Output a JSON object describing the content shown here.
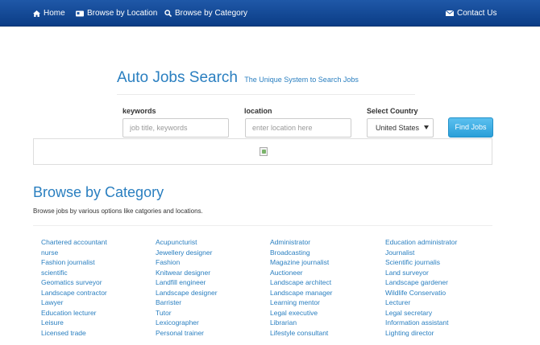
{
  "navbar": {
    "home": "Home",
    "browse_location": "Browse by Location",
    "browse_category": "Browse by Category",
    "contact": "Contact Us"
  },
  "hero": {
    "title": "Auto Jobs Search",
    "tagline": "The Unique System to Search Jobs"
  },
  "search": {
    "keywords_label": "keywords",
    "keywords_placeholder": "job title, keywords",
    "location_label": "location",
    "location_placeholder": "enter location here",
    "country_label": "Select Country",
    "country_value": "United States",
    "find_button": "Find Jobs"
  },
  "categories": {
    "title": "Browse by Category",
    "description": "Browse jobs by various options like catgories and locations.",
    "columns": [
      [
        "Chartered accountant",
        "nurse",
        "Fashion journalist",
        "scientific",
        "Geomatics surveyor",
        "Landscape contractor",
        "Lawyer",
        "Education lecturer",
        "Leisure",
        "Licensed trade"
      ],
      [
        "Acupuncturist",
        "Jewellery designer",
        "Fashion",
        "Knitwear designer",
        "Landfill engineer",
        "Landscape designer",
        "Barrister",
        "Tutor",
        "Lexicographer",
        "Personal trainer"
      ],
      [
        "Administrator",
        "Broadcasting",
        "Magazine journalist",
        "Auctioneer",
        "Landscape architect",
        "Landscape manager",
        "Learning mentor",
        "Legal executive",
        "Librarian",
        "Lifestyle consultant"
      ],
      [
        "Education administrator",
        "Journalist",
        "Scientific journalis",
        "Land surveyor",
        "Landscape gardener",
        "Wildlife Conservatio",
        "Lecturer",
        "Legal secretary",
        "Information assistant",
        "Lighting director"
      ]
    ]
  },
  "colors": {
    "navbar": "#0b3d86",
    "accent": "#2a7fc0",
    "button": "#2a9fd8"
  }
}
